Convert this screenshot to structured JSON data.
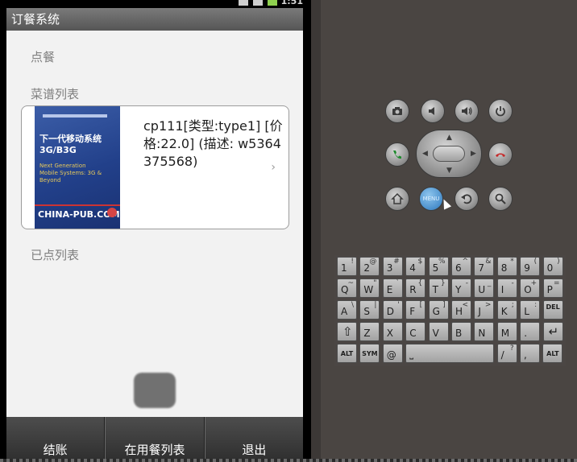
{
  "status_bar": {
    "time": "1:51"
  },
  "app": {
    "title": "订餐系统",
    "order_section_label": "点餐",
    "menu_section_label": "菜谱列表",
    "ordered_section_label": "已点列表",
    "menu_items": [
      {
        "description": "cp111[类型:type1] [价格:22.0] (描述: w5364375568)",
        "cover": {
          "title_cn": "下一代移动系统",
          "title_sub": "3G/B3G",
          "title_en": "Next Generation Mobile Systems: 3G & Beyond",
          "publisher": "CHINA-PUB.COM"
        },
        "chevron": "›"
      }
    ],
    "bottom_bar": {
      "checkout": "结账",
      "dining_list": "在用餐列表",
      "exit": "退出"
    }
  },
  "emulator": {
    "controls": {
      "camera_icon": "camera-icon",
      "volume_down_icon": "volume-down-icon",
      "volume_up_icon": "volume-up-icon",
      "power_icon": "power-icon",
      "call_icon": "call-icon",
      "end_call_icon": "end-call-icon",
      "home_icon": "home-icon",
      "menu_label": "MENU",
      "back_icon": "back-icon",
      "search_icon": "search-icon"
    },
    "keyboard": {
      "row1": [
        [
          "1",
          "!"
        ],
        [
          "2",
          "@"
        ],
        [
          "3",
          "#"
        ],
        [
          "4",
          "$"
        ],
        [
          "5",
          "%"
        ],
        [
          "6",
          "^"
        ],
        [
          "7",
          "&"
        ],
        [
          "8",
          "*"
        ],
        [
          "9",
          "("
        ],
        [
          "0",
          ")"
        ]
      ],
      "row2": [
        [
          "Q",
          "~"
        ],
        [
          "W",
          "\""
        ],
        [
          "E",
          "`"
        ],
        [
          "R",
          "{"
        ],
        [
          "T",
          "}"
        ],
        [
          "Y",
          "-"
        ],
        [
          "U",
          "_"
        ],
        [
          "I",
          "-"
        ],
        [
          "O",
          "+"
        ],
        [
          "P",
          "="
        ]
      ],
      "row3": [
        [
          "A",
          "\\"
        ],
        [
          "S",
          "|"
        ],
        [
          "D",
          "'"
        ],
        [
          "F",
          "["
        ],
        [
          "G",
          "]"
        ],
        [
          "H",
          "<"
        ],
        [
          "J",
          ">"
        ],
        [
          "K",
          ";"
        ],
        [
          "L",
          ":"
        ],
        [
          "DEL",
          ""
        ]
      ],
      "row4": [
        [
          "⇧",
          ""
        ],
        [
          "Z",
          ""
        ],
        [
          "X",
          ""
        ],
        [
          "C",
          ""
        ],
        [
          "V",
          ""
        ],
        [
          "B",
          ""
        ],
        [
          "N",
          ""
        ],
        [
          "M",
          ""
        ],
        [
          ".",
          ""
        ],
        [
          "↵",
          ""
        ]
      ],
      "row5": {
        "alt_left": "ALT",
        "sym": "SYM",
        "at": "@",
        "space": "⎵",
        "slash": "/",
        "question": "?",
        "comma": ",",
        "alt_right": "ALT"
      }
    }
  }
}
